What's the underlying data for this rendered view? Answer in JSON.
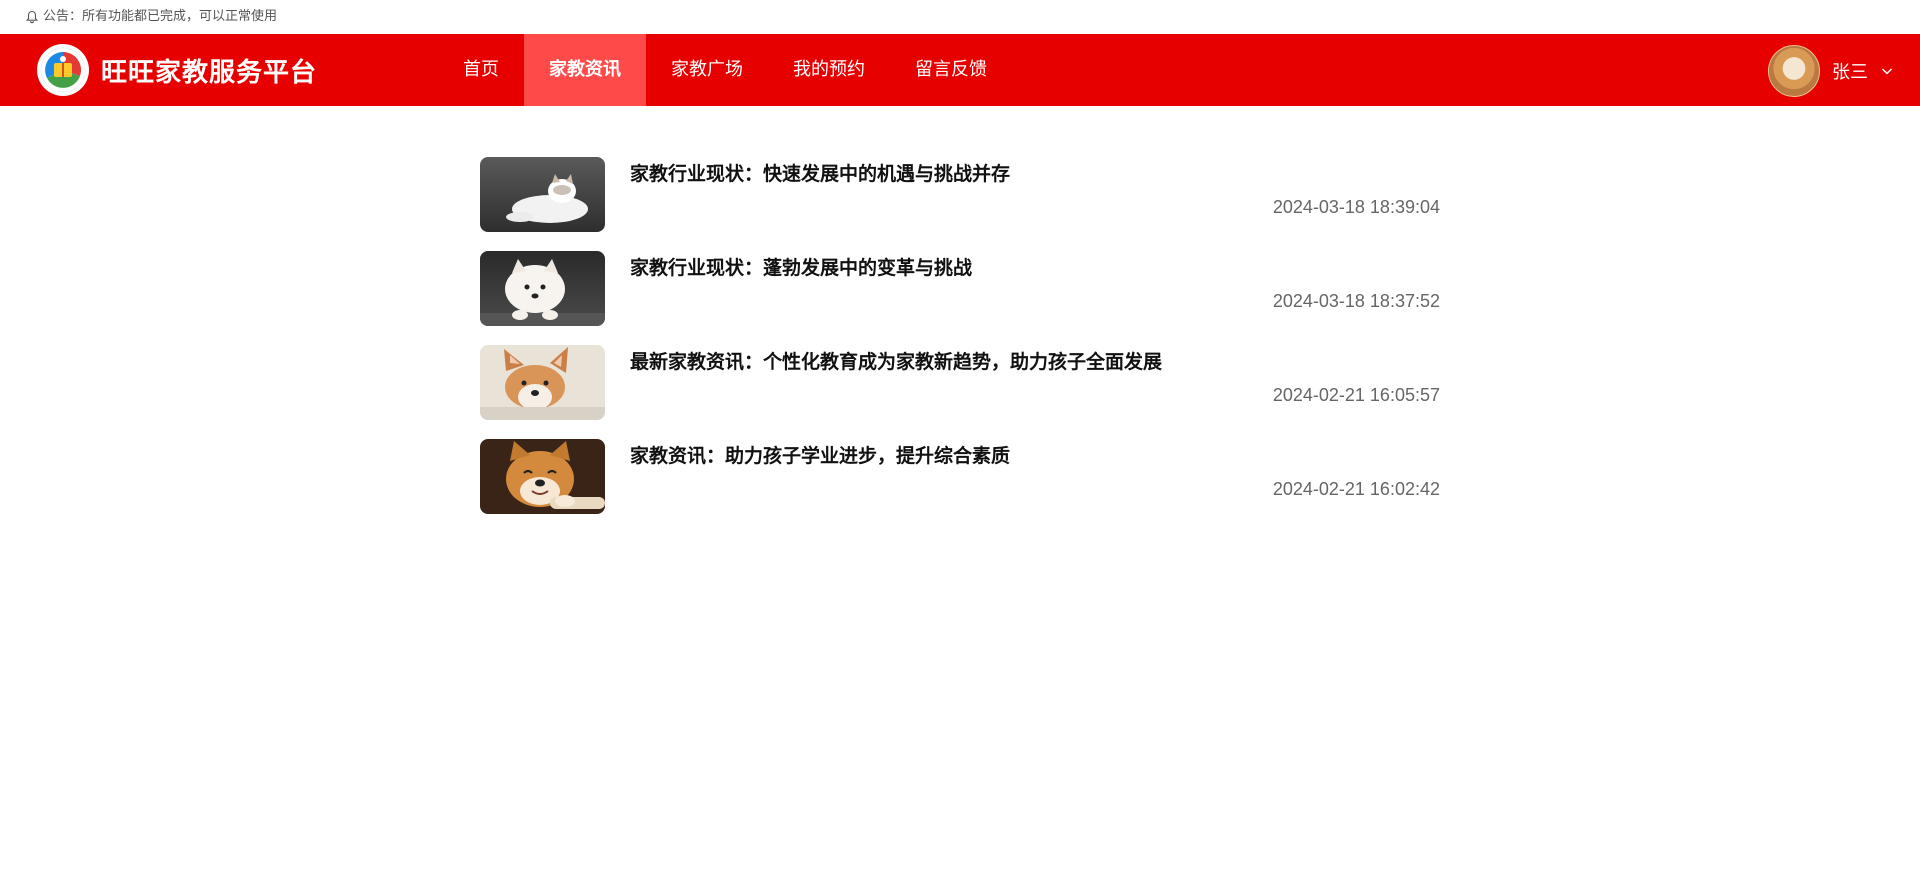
{
  "notice": {
    "text": "公告：所有功能都已完成，可以正常使用",
    "icon": "bell-icon"
  },
  "brand": {
    "title": "旺旺家教服务平台",
    "logo": "brand-logo-icon"
  },
  "nav": [
    {
      "label": "首页",
      "active": false
    },
    {
      "label": "家教资讯",
      "active": true
    },
    {
      "label": "家教广场",
      "active": false
    },
    {
      "label": "我的预约",
      "active": false
    },
    {
      "label": "留言反馈",
      "active": false
    }
  ],
  "user": {
    "name": "张三",
    "icon": "chevron-down-icon"
  },
  "news": [
    {
      "title": "家教行业现状：快速发展中的机遇与挑战并存",
      "time": "2024-03-18 18:39:04"
    },
    {
      "title": "家教行业现状：蓬勃发展中的变革与挑战",
      "time": "2024-03-18 18:37:52"
    },
    {
      "title": "最新家教资讯：个性化教育成为家教新趋势，助力孩子全面发展",
      "time": "2024-02-21 16:05:57"
    },
    {
      "title": "家教资讯：助力孩子学业进步，提升综合素质",
      "time": "2024-02-21 16:02:42"
    }
  ],
  "colors": {
    "header_bg": "#e60000",
    "nav_active_bg": "#ff4a4a"
  }
}
